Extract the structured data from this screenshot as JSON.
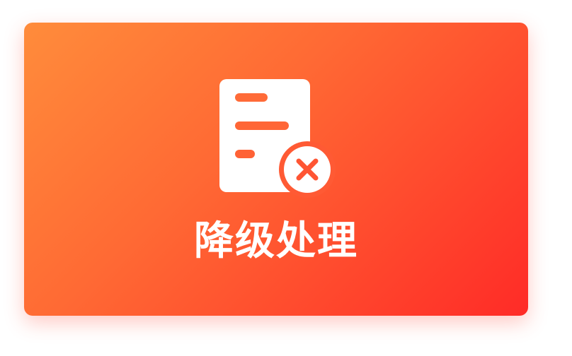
{
  "card": {
    "label": "降级处理",
    "icon": "document-error-icon"
  },
  "colors": {
    "gradient_start": "#ff8c3b",
    "gradient_end": "#ff2b27",
    "icon_fill": "#ffffff",
    "accent": "#ff5b35"
  }
}
